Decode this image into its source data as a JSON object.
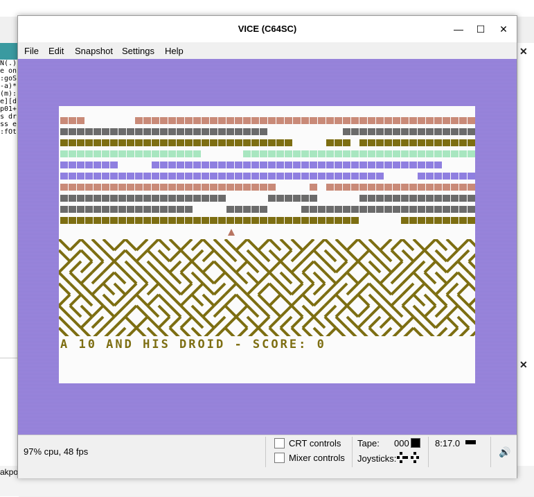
{
  "window": {
    "title": "VICE (C64SC)",
    "minimize_glyph": "—",
    "maximize_glyph": "☐",
    "close_glyph": "✕"
  },
  "menu": [
    "File",
    "Edit",
    "Snapshot",
    "Settings",
    "Help"
  ],
  "screen": {
    "border_color": "#9a86df",
    "text_line": "A 10 AND HIS DROID - SCORE: 0",
    "text_color": "#7d6e12"
  },
  "status": {
    "cpu": "97% cpu, 48 fps",
    "crt_controls": "CRT controls",
    "mixer_controls": "Mixer controls",
    "tape_label": "Tape:",
    "tape_counter": "000",
    "joysticks_label": "Joysticks:",
    "time": "8:17.0"
  },
  "background": {
    "code_lines": [
      "N(.)",
      "e on",
      ":goS",
      "-a)*",
      "(m):",
      "e][d",
      "p01+",
      "s dr",
      "ss e",
      ":fOt"
    ],
    "bottom_left_text": "akpoi"
  }
}
